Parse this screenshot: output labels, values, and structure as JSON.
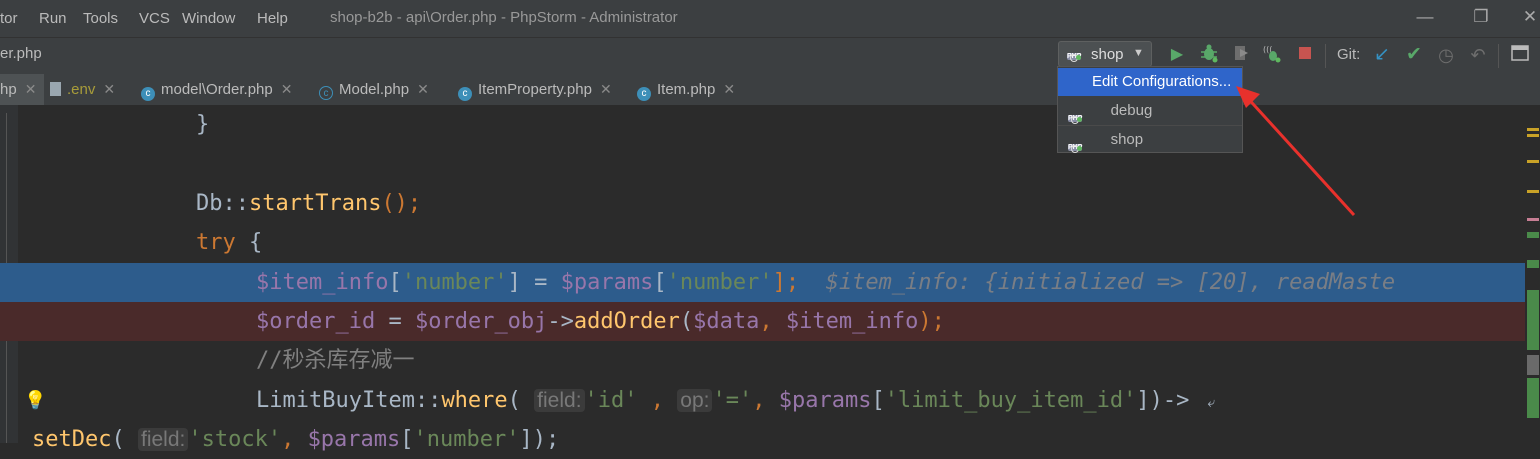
{
  "window": {
    "title": "shop-b2b - api\\Order.php - PhpStorm - Administrator",
    "menu": [
      "tor",
      "Run",
      "Tools",
      "VCS",
      "Window",
      "Help"
    ],
    "controls": {
      "minimize": "—",
      "restore": "❐",
      "close": "✕"
    }
  },
  "toolbar": {
    "breadcrumb": "er.php",
    "run_config": "shop",
    "git_label": "Git:"
  },
  "tabs": [
    {
      "label": "hp",
      "icon": "php-class-icon"
    },
    {
      "label": ".env",
      "icon": "file-icon"
    },
    {
      "label": "model\\Order.php",
      "icon": "class-icon"
    },
    {
      "label": "Model.php",
      "icon": "abstract-class-icon"
    },
    {
      "label": "ItemProperty.php",
      "icon": "class-icon"
    },
    {
      "label": "Item.php",
      "icon": "class-icon"
    }
  ],
  "popup": {
    "items": [
      {
        "label": "Edit Configurations...",
        "selected": true
      },
      {
        "label": "debug",
        "selected": false
      },
      {
        "label": "shop",
        "selected": false
      }
    ]
  },
  "code": {
    "l1": "}",
    "l3_class": "Db::",
    "l3_fn": "startTrans",
    "l3_rest": "();",
    "l4_kw": "try",
    "l4_rest": " {",
    "l5_var1": "$item_info",
    "l5_b1": "[",
    "l5_s1": "'number'",
    "l5_b2": "] = ",
    "l5_var2": "$params",
    "l5_b3": "[",
    "l5_s2": "'number'",
    "l5_b4": "];",
    "l5_debug": "  $item_info: {initialized => [20], readMaste",
    "l6_var1": "$order_id",
    "l6_eq": " = ",
    "l6_var2": "$order_obj",
    "l6_arrow": "->",
    "l6_fn": "addOrder",
    "l6_p1": "(",
    "l6_var3": "$data",
    "l6_comma": ", ",
    "l6_var4": "$item_info",
    "l6_p2": ");",
    "l7_comment": "//秒杀库存减一",
    "l8_class": "LimitBuyItem::",
    "l8_fn": "where",
    "l8_p1": "( ",
    "l8_hint1": "field:",
    "l8_s1": "'id'",
    "l8_c1": " , ",
    "l8_hint2": "op:",
    "l8_s2": "'='",
    "l8_c2": ", ",
    "l8_var": "$params",
    "l8_b1": "[",
    "l8_s3": "'limit_buy_item_id'",
    "l8_b2": "])->",
    "l9_fn": "setDec",
    "l9_p1": "( ",
    "l9_hint": "field:",
    "l9_s1": "'stock'",
    "l9_c1": ", ",
    "l9_var": "$params",
    "l9_b1": "[",
    "l9_s2": "'number'",
    "l9_b2": "]);"
  },
  "colors": {
    "keyword": "#cc7832",
    "function": "#ffc66d",
    "variable": "#9876aa",
    "string": "#6a8759",
    "selection": "#2f65ca",
    "arrow": "#e8312c"
  }
}
